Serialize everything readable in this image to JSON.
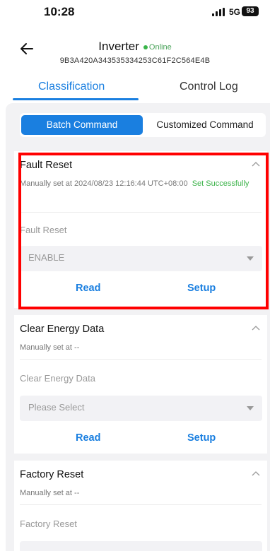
{
  "status": {
    "time": "10:28",
    "network": "5G",
    "battery": "93"
  },
  "header": {
    "title": "Inverter",
    "status": "Online",
    "serial": "9B3A420A343535334253C61F2C564E4B"
  },
  "tabs": [
    {
      "label": "Classification",
      "active": true
    },
    {
      "label": "Control Log",
      "active": false
    }
  ],
  "segment": {
    "batch": "Batch Command",
    "custom": "Customized Command"
  },
  "cards": [
    {
      "title": "Fault Reset",
      "sub_prefix": "Manually set at 2024/08/23 12:16:44 UTC+08:00",
      "sub_status": "Set Successfully",
      "field_label": "Fault Reset",
      "select_value": "ENABLE",
      "read": "Read",
      "setup": "Setup"
    },
    {
      "title": "Clear Energy Data",
      "sub_prefix": "Manually set at --",
      "field_label": "Clear Energy Data",
      "select_value": "Please Select",
      "read": "Read",
      "setup": "Setup"
    },
    {
      "title": "Factory Reset",
      "sub_prefix": "Manually set at --",
      "field_label": "Factory Reset"
    }
  ],
  "colors": {
    "accent": "#1a7fe0",
    "online": "#39b54a",
    "success": "#3cb34a",
    "highlight": "#ff0000"
  }
}
